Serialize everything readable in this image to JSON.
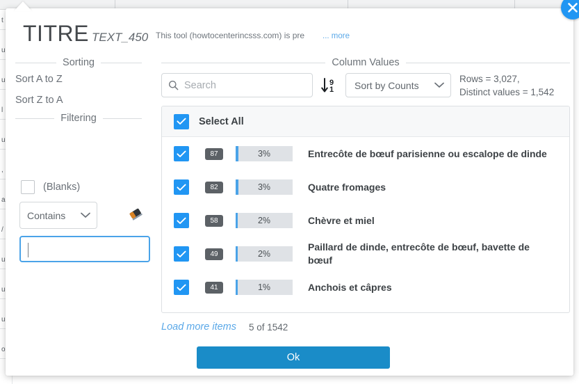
{
  "background": {
    "cell_fragments": [
      "t",
      "u",
      "u",
      "l",
      "u",
      ",",
      "a",
      "/",
      "u",
      "u",
      "u",
      "o"
    ]
  },
  "dialog": {
    "close_icon": "close-icon",
    "header": {
      "title": "TITRE",
      "subtitle": "TEXT_450",
      "description": "This tool (howtocenterincsss.com) is pre",
      "more_link": "... more"
    },
    "sorting": {
      "legend": "Sorting",
      "sort_az": "Sort A to Z",
      "sort_za": "Sort Z to A"
    },
    "filtering": {
      "legend": "Filtering",
      "blanks_label": "(Blanks)",
      "blanks_checked": false,
      "operator": "Contains",
      "eraser_icon": "eraser-icon",
      "filter_value": "",
      "filter_placeholder": ""
    },
    "column_values": {
      "legend": "Column Values",
      "search_placeholder": "Search",
      "search_value": "",
      "search_icon": "search-icon",
      "sort_direction_icon": "sort-descending-9-to-1-icon",
      "sort_by": "Sort by Counts",
      "stats_rows": "Rows = 3,027,",
      "stats_distinct": "Distinct values = 1,542",
      "select_all_label": "Select All",
      "select_all_checked": true,
      "items": [
        {
          "checked": true,
          "count": "87",
          "percent": "3%",
          "fill": 4,
          "label": "Entrecôte de bœuf parisienne ou escalope de dinde"
        },
        {
          "checked": true,
          "count": "82",
          "percent": "3%",
          "fill": 4,
          "label": "Quatre fromages"
        },
        {
          "checked": true,
          "count": "58",
          "percent": "2%",
          "fill": 3,
          "label": "Chèvre et miel"
        },
        {
          "checked": true,
          "count": "49",
          "percent": "2%",
          "fill": 3,
          "label": "Paillard de dinde, entrecôte de bœuf, bavette de bœuf"
        },
        {
          "checked": true,
          "count": "41",
          "percent": "1%",
          "fill": 3,
          "label": "Anchois et câpres"
        }
      ],
      "load_more": "Load more items",
      "shown_of_total": "5 of 1542"
    },
    "ok_label": "Ok"
  },
  "colors": {
    "accent_blue": "#2196f3",
    "ok_button": "#1a8cc8",
    "link_blue": "#5aa8e8",
    "badge_gray": "#5c6166",
    "bar_gray": "#dfe2e6"
  }
}
